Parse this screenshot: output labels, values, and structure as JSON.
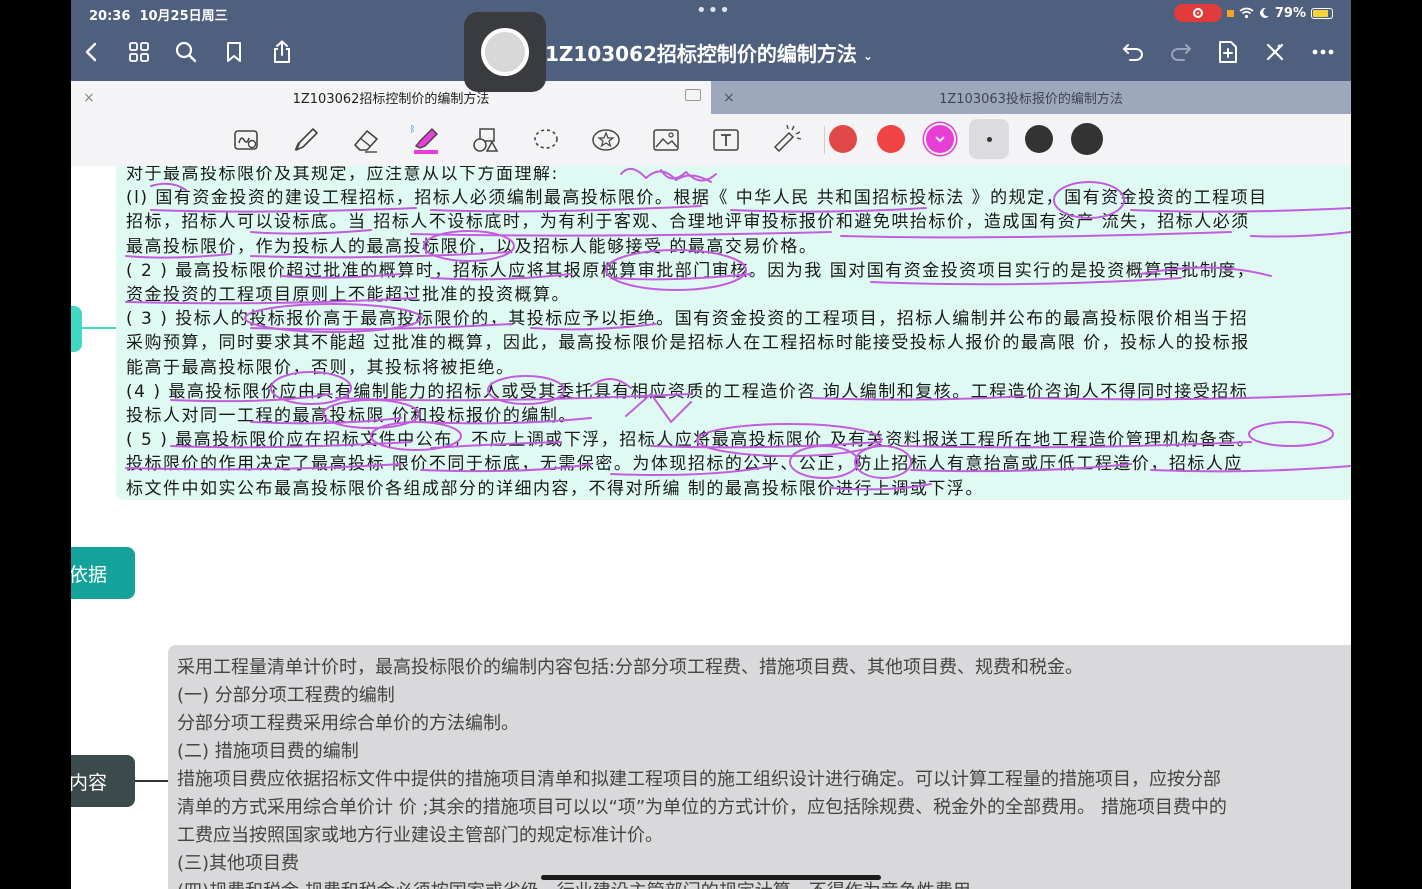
{
  "status_bar": {
    "time": "20:36",
    "date": "10月25日周三",
    "dots": "•••",
    "battery": "79%"
  },
  "toolbar": {
    "title": "1Z103062招标控制价的编制方法",
    "title_chevron": "⌄",
    "icons": [
      "back-icon",
      "grid-icon",
      "search-icon",
      "bookmark-icon",
      "share-icon",
      "undo-icon",
      "redo-icon",
      "add-page-icon",
      "close-x-icon",
      "more-icon"
    ]
  },
  "tabs": [
    {
      "label": "1Z103062招标控制价的编制方法",
      "close": "×"
    },
    {
      "label": "1Z103063投标报价的编制方法",
      "close": "×"
    }
  ],
  "tools": {
    "items": [
      "lasso-handwriting-icon",
      "pen-icon",
      "eraser-icon",
      "highlighter-icon",
      "shapes-icon",
      "lasso-icon",
      "sticker-icon",
      "image-icon",
      "text-icon",
      "laser-pointer-icon"
    ],
    "colors": [
      "#e04848",
      "#f04444",
      "#e83ed8"
    ],
    "sizes": [
      "small",
      "medium",
      "large"
    ],
    "size_dot_color": "#333333",
    "accent": "#e83ed8"
  },
  "mindmap": {
    "basis_label": "依据",
    "content_label": "内容"
  },
  "green_note": {
    "lines": [
      "对于最高投标限价及其规定，应注意从以下方面理解:",
      "(l) 国有资金投资的建设工程招标，招标人必须编制最高投标限价。根据《 中华人民 共和国招标投标法 》的规定，国有资金投资的工程项目",
      "招标，招标人可以设标底。当 招标人不设标底时，为有利于客观、合理地评审投标报价和避免哄抬标价，造成国有资产 流失，招标人必须",
      "最高投标限价，作为投标人的最高投标限价，以及招标人能够接受 的最高交易价格。",
      "( 2 ) 最高投标限价超过批准的概算时，招标人应将其报原概算审批部门审核。因为我 国对国有资金投资项目实行的是投资概算审批制度，",
      "资金投资的工程项目原则上不能超过批准的投资概算。",
      "( 3 ) 投标人的投标报价高于最高投标限价的，其投标应予以拒绝。国有资金投资的工程项目，招标人编制并公布的最高投标限价相当于招",
      "采购预算，同时要求其不能超 过批准的概算，因此，最高投标限价是招标人在工程招标时能接受投标人报价的最高限 价，投标人的投标报",
      "能高于最高投标限价，否则，其投标将被拒绝。",
      "(4 ) 最高投标限价应由具有编制能力的招标人或受其委托具有相应资质的工程造价咨 询人编制和复核。工程造价咨询人不得同时接受招标",
      "投标人对同一工程的最高投标限 价和投标报价的编制。",
      "( 5 ) 最高投标限价应在招标文件中公布，不应上调或下浮，招标人应将最高投标限价 及有关资料报送工程所在地工程造价管理机构备查。",
      "投标限价的作用决定了最高投标 限价不同于标底，无需保密。为体现招标的公平、公正，防止招标人有意抬高或压低工程造价，招标人应",
      "标文件中如实公布最高投标限价各组成部分的详细内容，不得对所编 制的最高投标限价进行上调或下浮。"
    ]
  },
  "gray_note": {
    "lines": [
      "采用工程量清单计价时，最高投标限价的编制内容包括:分部分项工程费、措施项目费、其他项目费、规费和税金。",
      "(一) 分部分项工程费的编制",
      "分部分项工程费采用综合单价的方法编制。",
      "(二) 措施项目费的编制",
      "措施项目费应依据招标文件中提供的措施项目清单和拟建工程项目的施工组织设计进行确定。可以计算工程量的措施项目，应按分部",
      "清单的方式采用综合单价计 价 ;其余的措施项目可以以“项”为单位的方式计价，应包括除规费、税金外的全部费用。 措施项目费中的",
      "工费应当按照国家或地方行业建设主管部门的规定标准计价。",
      "(三)其他项目费",
      "(四)规费和税金 规费和税金必须按国家或省级、行业建设主管部门的规定计算，不得作为竞争性费用。"
    ]
  }
}
